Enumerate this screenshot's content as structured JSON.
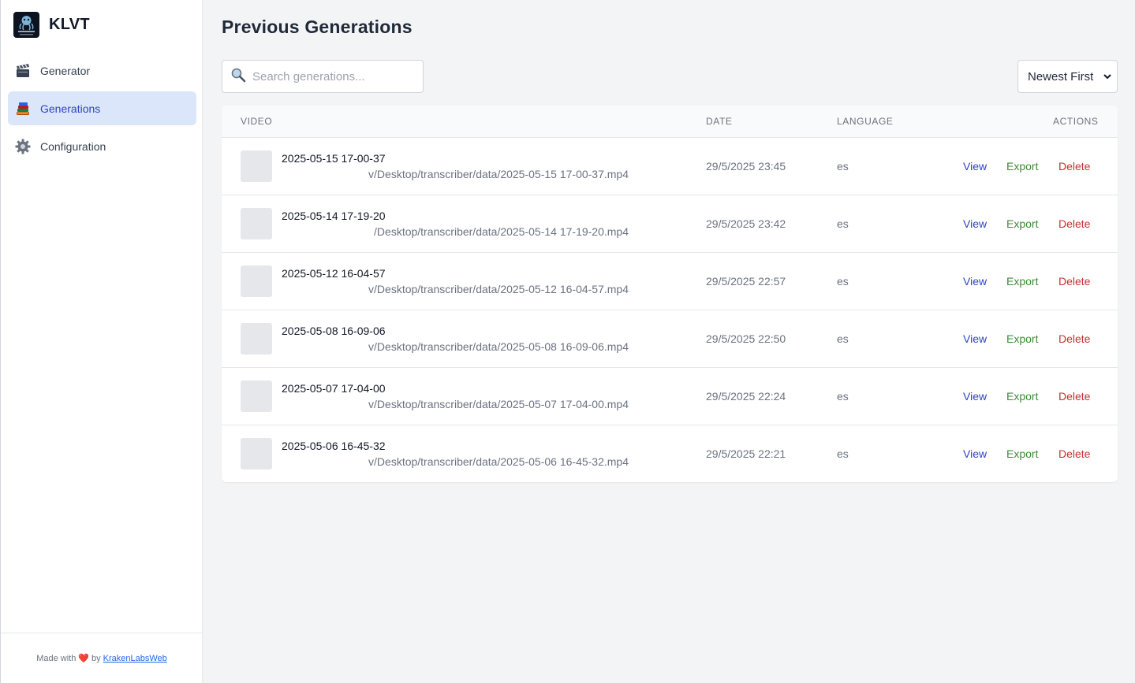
{
  "app": {
    "name": "KLVT"
  },
  "sidebar": {
    "items": [
      {
        "label": "Generator",
        "icon": "clapperboard-icon",
        "active": false
      },
      {
        "label": "Generations",
        "icon": "books-icon",
        "active": true
      },
      {
        "label": "Configuration",
        "icon": "gear-icon",
        "active": false
      }
    ],
    "footer": {
      "prefix": "Made with",
      "heart": "❤️",
      "by": "by",
      "link": "KrakenLabsWeb"
    }
  },
  "page": {
    "title": "Previous Generations"
  },
  "search": {
    "placeholder": "Search generations..."
  },
  "sort": {
    "selected": "Newest First"
  },
  "table": {
    "headers": {
      "video": "VIDEO",
      "date": "DATE",
      "language": "LANGUAGE",
      "actions": "ACTIONS"
    },
    "actions": {
      "view": "View",
      "export": "Export",
      "delete": "Delete"
    },
    "rows": [
      {
        "title": "2025-05-15 17-00-37",
        "path": "v/Desktop/transcriber/data/2025-05-15 17-00-37.mp4",
        "date": "29/5/2025 23:45",
        "language": "es"
      },
      {
        "title": "2025-05-14 17-19-20",
        "path": "/Desktop/transcriber/data/2025-05-14 17-19-20.mp4",
        "date": "29/5/2025 23:42",
        "language": "es"
      },
      {
        "title": "2025-05-12 16-04-57",
        "path": "v/Desktop/transcriber/data/2025-05-12 16-04-57.mp4",
        "date": "29/5/2025 22:57",
        "language": "es"
      },
      {
        "title": "2025-05-08 16-09-06",
        "path": "v/Desktop/transcriber/data/2025-05-08 16-09-06.mp4",
        "date": "29/5/2025 22:50",
        "language": "es"
      },
      {
        "title": "2025-05-07 17-04-00",
        "path": "v/Desktop/transcriber/data/2025-05-07 17-04-00.mp4",
        "date": "29/5/2025 22:24",
        "language": "es"
      },
      {
        "title": "2025-05-06 16-45-32",
        "path": "v/Desktop/transcriber/data/2025-05-06 16-45-32.mp4",
        "date": "29/5/2025 22:21",
        "language": "es"
      }
    ]
  },
  "colors": {
    "accent": "#2f43c4",
    "activeNavBg": "#dbe6fb",
    "export": "#3d8b37",
    "delete": "#c53030"
  }
}
